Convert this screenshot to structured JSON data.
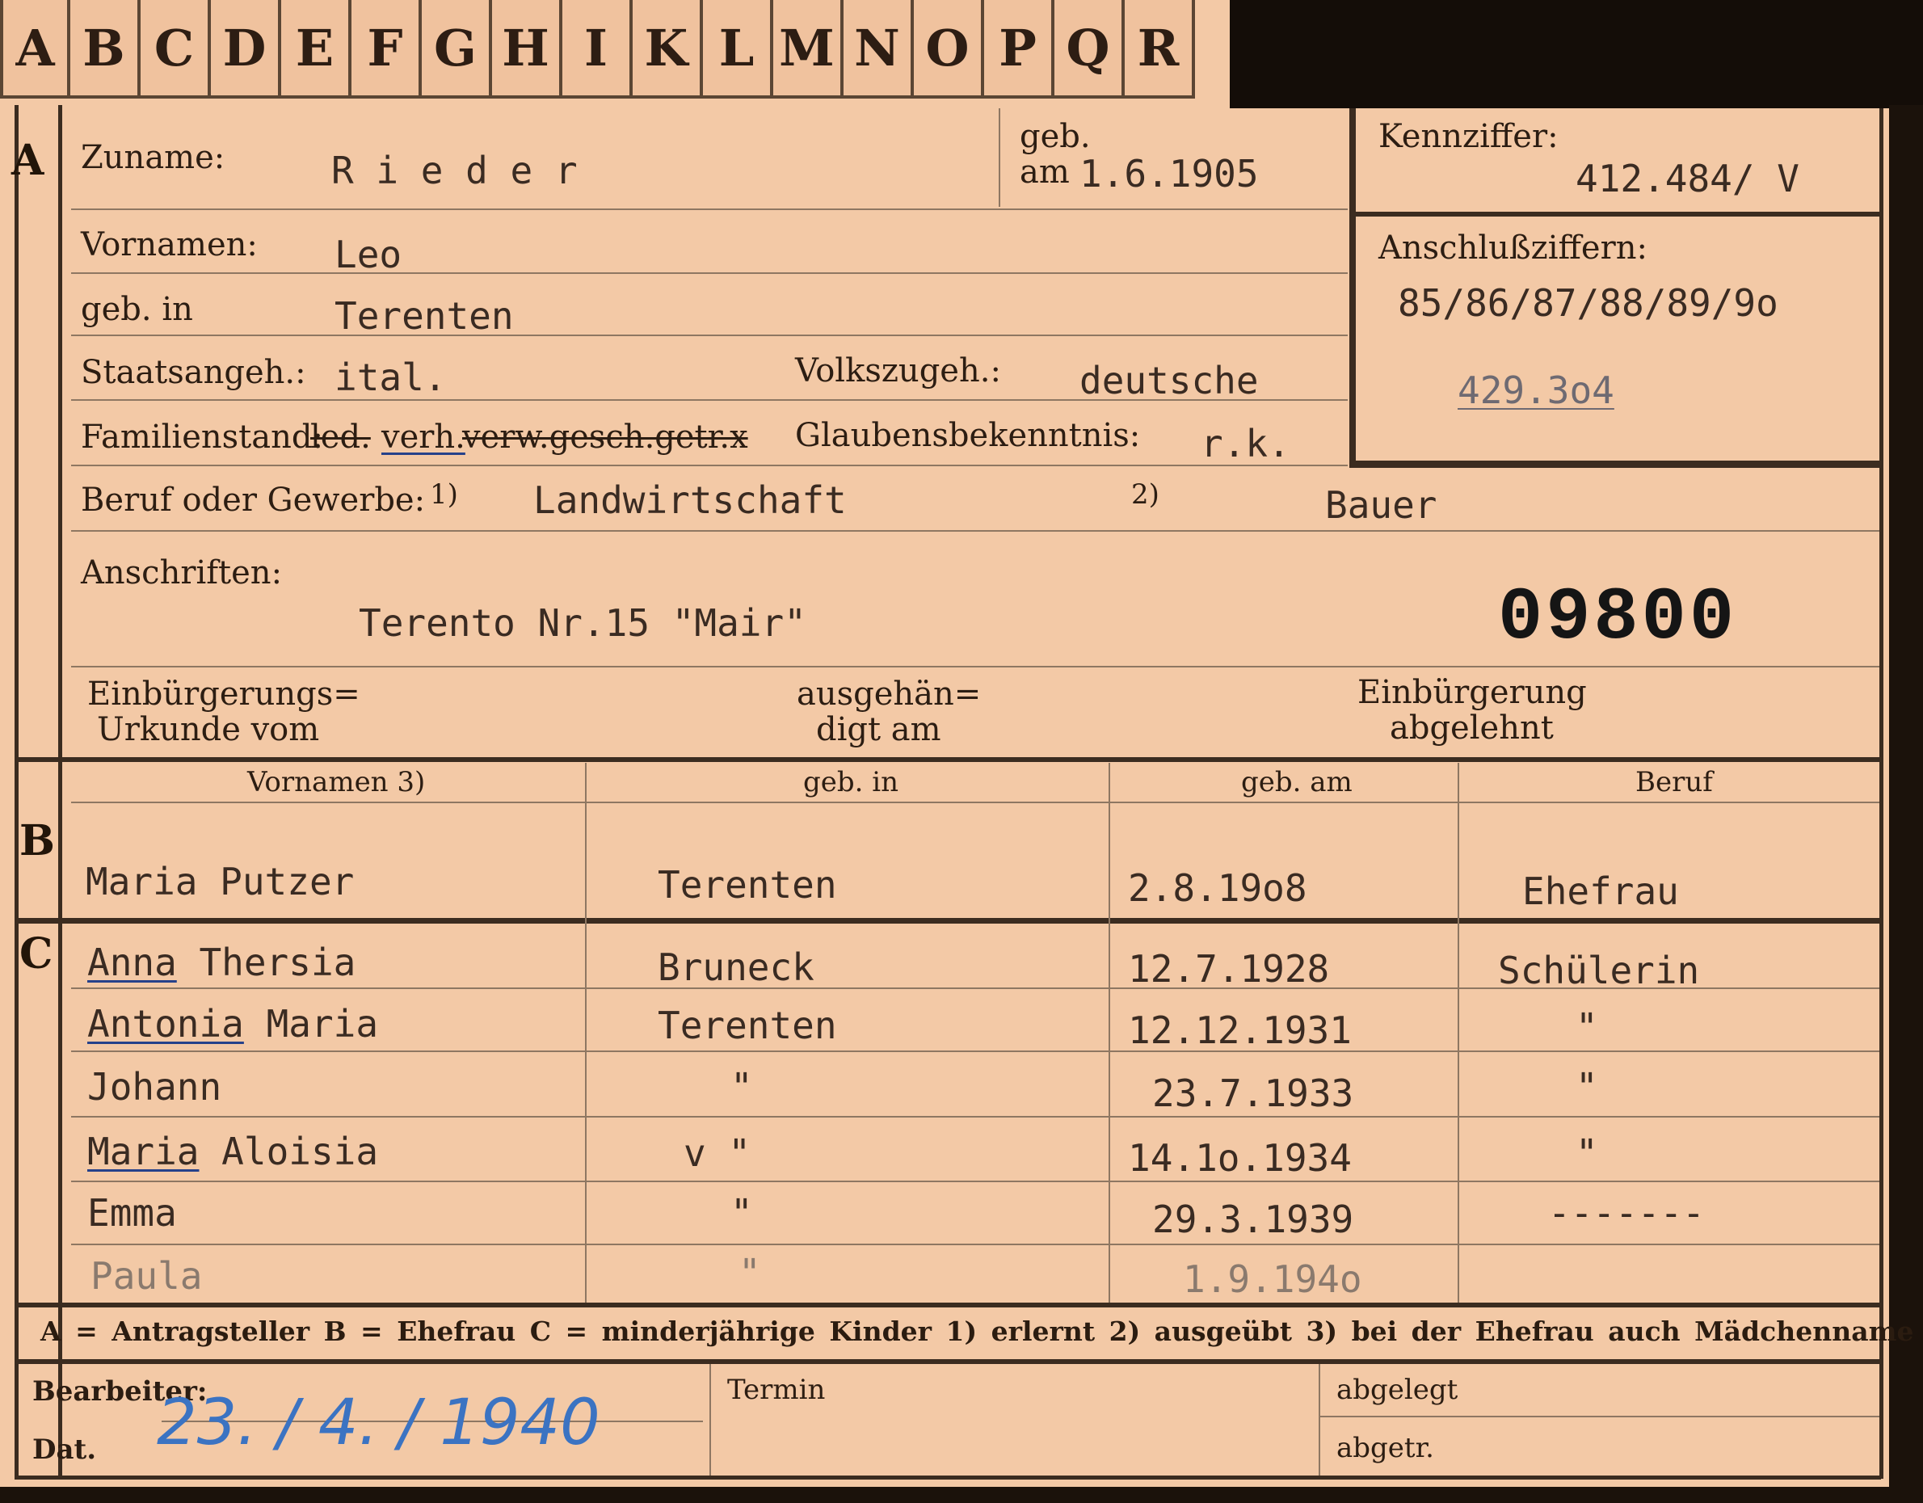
{
  "alphabet_tabs": [
    "A",
    "B",
    "C",
    "D",
    "E",
    "F",
    "G",
    "H",
    "I",
    "K",
    "L",
    "M",
    "N",
    "O",
    "P",
    "Q",
    "R"
  ],
  "section_a": {
    "marker": "A",
    "surname_label": "Zuname:",
    "surname": "R i e d e r",
    "birth_label_top": "geb.",
    "birth_label_am": "am",
    "birth_date": "1.6.1905",
    "first_names_label": "Vornamen:",
    "first_names": "Leo",
    "birthplace_label": "geb. in",
    "birthplace": "Terenten",
    "citizenship_label": "Staatsangeh.:",
    "citizenship": "ital.",
    "ethnicity_label": "Volkszugeh.:",
    "ethnicity": "deutsche",
    "marital_label": "Familienstand:",
    "marital_crossed_1": "led.",
    "marital_selected": "verh.",
    "marital_crossed_2": "verw.gesch.getr.x",
    "religion_label": "Glaubensbekenntnis:",
    "religion": "r.k.",
    "occupation_label": "Beruf oder Gewerbe:",
    "footnote_1": "1)",
    "occupation_learned": "Landwirtschaft",
    "footnote_2": "2)",
    "occupation_practiced": "Bauer",
    "address_label": "Anschriften:",
    "address": "Terento Nr.15 \"Mair\"",
    "stamp_number": "09800",
    "naturalization_label_1": "Einbürgerungs=",
    "naturalization_label_2": "Urkunde vom",
    "handed_label_1": "ausgehän=",
    "handed_label_2": "digt am",
    "rejected_label_1": "Einbürgerung",
    "rejected_label_2": "abgelehnt"
  },
  "ident_box": {
    "code_label": "Kennziffer:",
    "code": "412.484/ V",
    "linked_label": "Anschlußziffern:",
    "linked": "85/86/87/88/89/9o",
    "linked_extra": "429.3o4"
  },
  "table_header": {
    "col1": "Vornamen 3)",
    "col2": "geb. in",
    "col3": "geb. am",
    "col4": "Beruf"
  },
  "section_b": {
    "marker": "B",
    "name": "Maria Putzer",
    "place": "Terenten",
    "date": "2.8.19o8",
    "job": "Ehefrau"
  },
  "section_c": {
    "marker": "C",
    "children": [
      {
        "first": "Anna",
        "rest": " Thersia",
        "place": "Bruneck",
        "date": "12.7.1928",
        "job": "Schülerin"
      },
      {
        "first": "Antonia",
        "rest": " Maria",
        "place": "Terenten",
        "date": "12.12.1931",
        "job": "\""
      },
      {
        "first": "",
        "rest": "Johann",
        "place": "\"",
        "date": "23.7.1933",
        "job": "\""
      },
      {
        "first": "Maria",
        "rest": " Aloisia",
        "place": "v \"",
        "date": "14.1o.1934",
        "job": "\""
      },
      {
        "first": "",
        "rest": "Emma",
        "place": "\"",
        "date": "29.3.1939",
        "job": "-------"
      },
      {
        "first": "",
        "rest": "Paula",
        "place": "\"",
        "date": "1.9.194o",
        "job": ""
      }
    ]
  },
  "legend": "A = Antragsteller   B = Ehefrau   C = minderjährige Kinder   1) erlernt   2) ausgeübt   3) bei der Ehefrau auch Mädchenname",
  "footer": {
    "clerk_label": "Bearbeiter:",
    "date_label": "Dat.",
    "date_handwritten": "23. / 4. / 1940",
    "term_label": "Termin",
    "filed_label": "abgelegt",
    "crossed_out_label": "abgetr."
  }
}
